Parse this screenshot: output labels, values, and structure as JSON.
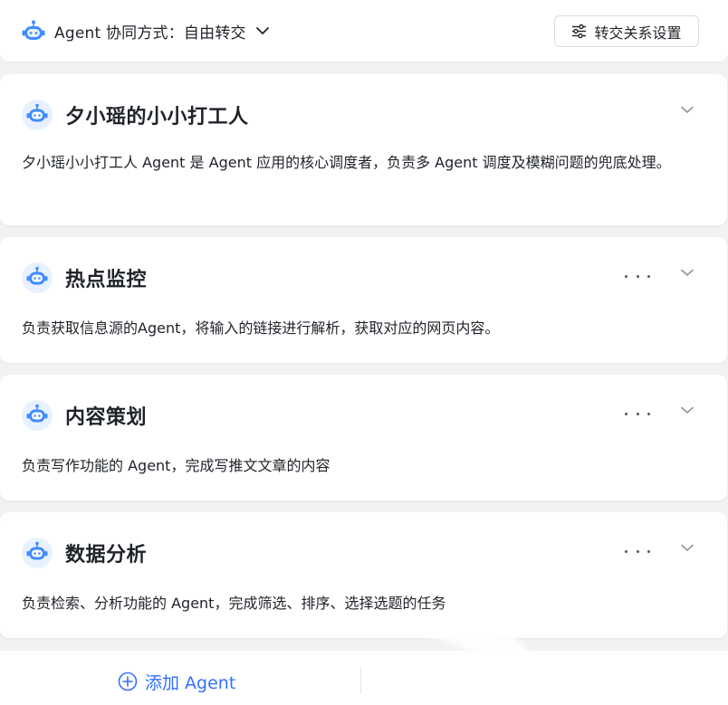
{
  "header": {
    "mode_label": "Agent 协同方式：自由转交",
    "handoff_settings_label": "转交关系设置"
  },
  "agents": [
    {
      "title": "夕小瑶的小小打工人",
      "description": "夕小瑶小小打工人 Agent 是 Agent 应用的核心调度者，负责多 Agent 调度及模糊问题的兜底处理。",
      "has_more": false
    },
    {
      "title": "热点监控",
      "description": "负责获取信息源的Agent，将输入的链接进行解析，获取对应的网页内容。",
      "has_more": true
    },
    {
      "title": "内容策划",
      "description": "负责写作功能的 Agent，完成写推文文章的内容",
      "has_more": true
    },
    {
      "title": "数据分析",
      "description": "负责检索、分析功能的 Agent，完成筛选、排序、选择选题的任务",
      "has_more": true
    }
  ],
  "footer": {
    "add_agent_label": "添加 Agent"
  },
  "colors": {
    "accent": "#3370ff",
    "bot_head": "#3f8cff",
    "bot_face": "#e8f1ff",
    "page_bg": "#f1f2f4"
  },
  "icons": {
    "mode_icon": "robot-icon",
    "agent_icon": "robot-icon",
    "handoff_icon": "sliders-icon",
    "collapse_icon": "chevron-down-icon",
    "more_icon": "more-horizontal-icon",
    "add_icon": "plus-circle-icon"
  }
}
